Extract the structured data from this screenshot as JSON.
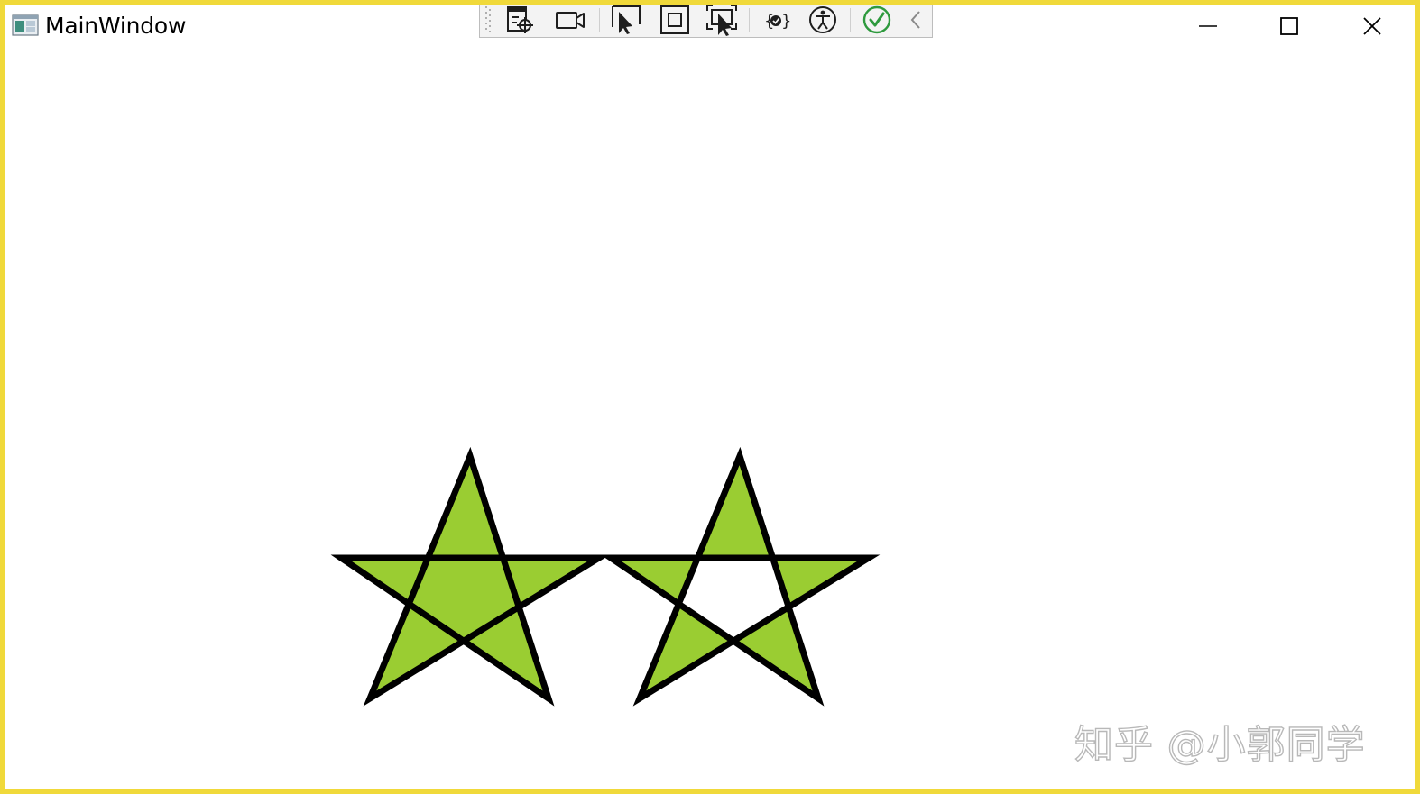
{
  "window": {
    "title": "MainWindow",
    "border_color": "#f0d93a",
    "caption_buttons": [
      "minimize",
      "maximize",
      "close"
    ]
  },
  "debug_toolbar": {
    "items": [
      {
        "icon": "select-element-icon"
      },
      {
        "icon": "video-camera-icon"
      },
      {
        "icon": "pointer-select-icon"
      },
      {
        "icon": "display-layout-adorners-icon"
      },
      {
        "icon": "track-focus-icon"
      },
      {
        "icon": "binding-failures-icon"
      },
      {
        "icon": "accessibility-icon"
      },
      {
        "icon": "checkmark-icon"
      },
      {
        "icon": "collapse-chevron-left-icon"
      }
    ]
  },
  "shapes": {
    "fill_color": "#9acd32",
    "stroke_color": "#000000",
    "stars": [
      {
        "name": "star-nonzero-fill",
        "fill_rule": "nonzero"
      },
      {
        "name": "star-evenodd-fill",
        "fill_rule": "evenodd"
      }
    ]
  },
  "watermark": {
    "text": "知乎 @小郭同学"
  }
}
